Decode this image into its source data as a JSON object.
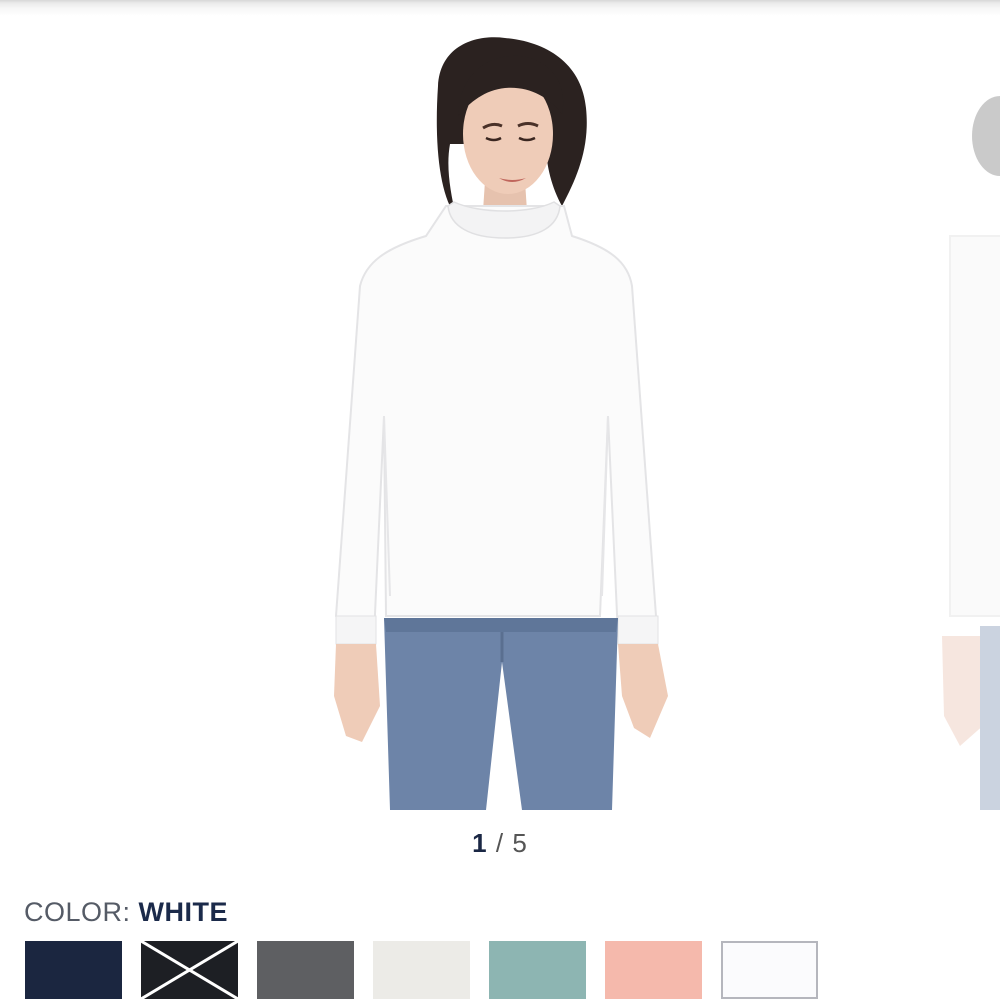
{
  "carousel": {
    "current": "1",
    "separator": "/",
    "total": "5"
  },
  "color": {
    "label": "COLOR:",
    "selected": "WHITE"
  },
  "swatches": [
    {
      "name": "swatch-navy",
      "color": "#1b2640"
    },
    {
      "name": "swatch-black-white-pattern",
      "color": "#1d1f24"
    },
    {
      "name": "swatch-gray-heather",
      "color": "#5e5f62"
    },
    {
      "name": "swatch-ivory",
      "color": "#ecebe7"
    },
    {
      "name": "swatch-sage",
      "color": "#8db5b2"
    },
    {
      "name": "swatch-peach",
      "color": "#f5b9ac"
    },
    {
      "name": "swatch-white",
      "color": "#fbfbfd"
    }
  ]
}
